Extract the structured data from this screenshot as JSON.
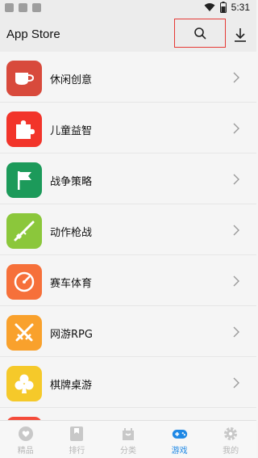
{
  "status_bar": {
    "time": "5:31"
  },
  "app_bar": {
    "title": "App Store"
  },
  "categories": [
    {
      "label": "休闲创意",
      "color": "#d84a3c",
      "icon": "teacup-icon"
    },
    {
      "label": "儿童益智",
      "color": "#f2342a",
      "icon": "puzzle-icon"
    },
    {
      "label": "战争策略",
      "color": "#1c9a5a",
      "icon": "flag-icon"
    },
    {
      "label": "动作枪战",
      "color": "#8bc73b",
      "icon": "rifle-icon"
    },
    {
      "label": "赛车体育",
      "color": "#f6703a",
      "icon": "speedometer-icon"
    },
    {
      "label": "网游RPG",
      "color": "#f9a12c",
      "icon": "crossed-swords-icon"
    },
    {
      "label": "棋牌桌游",
      "color": "#f5c92a",
      "icon": "club-icon"
    },
    {
      "label": "",
      "color": "#f44b3a",
      "icon": "partial-icon"
    }
  ],
  "bottom_nav": [
    {
      "label": "精品",
      "icon": "heart-badge-icon",
      "active": false
    },
    {
      "label": "排行",
      "icon": "ranking-ribbon-icon",
      "active": false
    },
    {
      "label": "分类",
      "icon": "category-bag-icon",
      "active": false
    },
    {
      "label": "游戏",
      "icon": "gamepad-icon",
      "active": true
    },
    {
      "label": "我的",
      "icon": "gear-icon",
      "active": false
    }
  ],
  "colors": {
    "accent": "#1e88e5",
    "highlight_border": "#e53935"
  }
}
